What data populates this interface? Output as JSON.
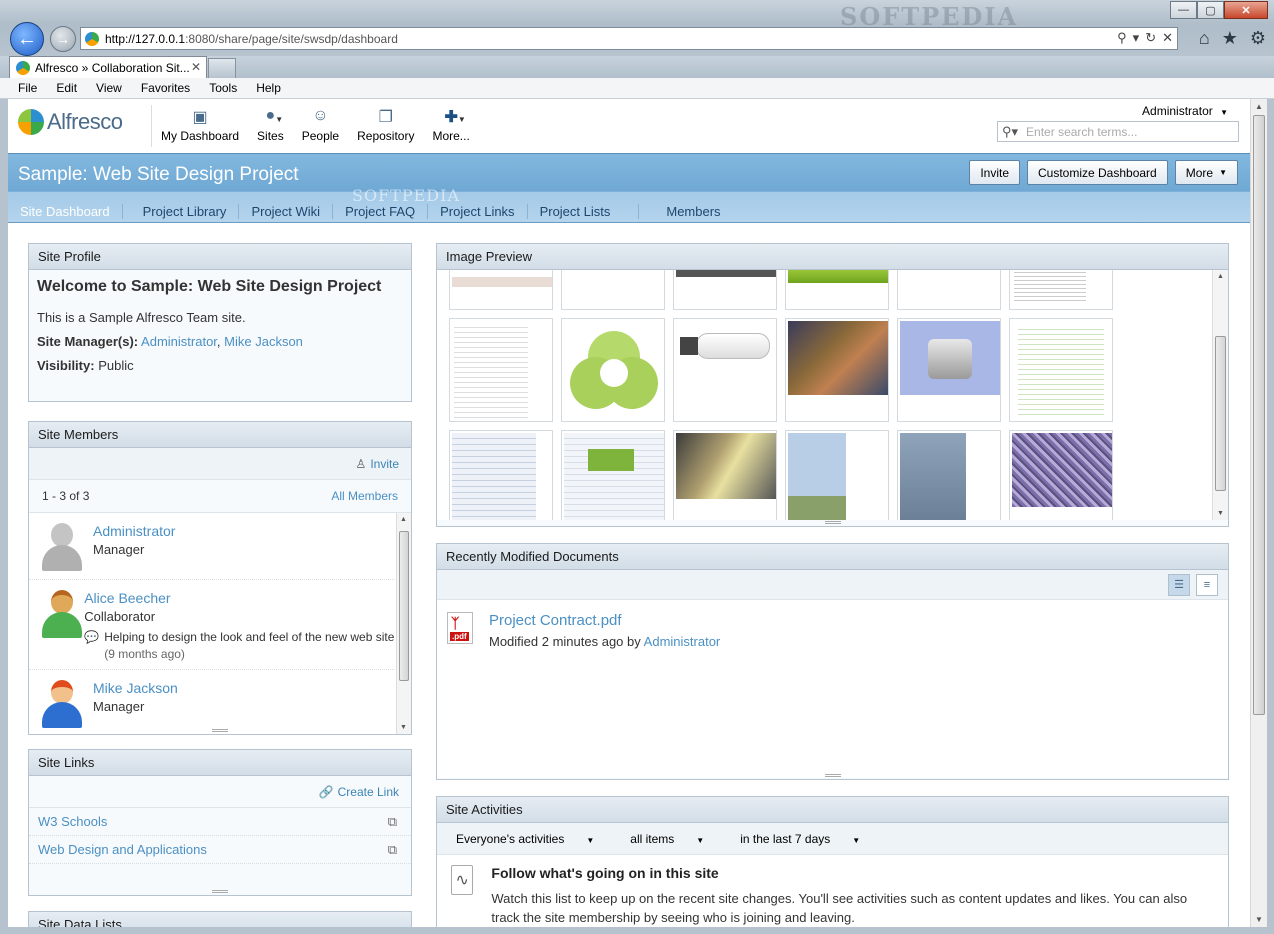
{
  "browser": {
    "watermark": "SOFTPEDIA",
    "window_controls": {
      "minimize": "—",
      "maximize": "▢",
      "close": "✕"
    },
    "url_host": "http://127.0.0.1",
    "url_path": ":8080/share/page/site/swsdp/dashboard",
    "tab_title": "Alfresco » Collaboration Sit...",
    "menu": [
      "File",
      "Edit",
      "View",
      "Favorites",
      "Tools",
      "Help"
    ]
  },
  "app": {
    "logo_text": "Alfresco",
    "nav": [
      {
        "label": "My Dashboard",
        "icon": "dashboard-icon"
      },
      {
        "label": "Sites",
        "icon": "globe-icon"
      },
      {
        "label": "People",
        "icon": "people-icon"
      },
      {
        "label": "Repository",
        "icon": "repository-icon"
      },
      {
        "label": "More...",
        "icon": "plus-icon"
      }
    ],
    "user": "Administrator",
    "search_placeholder": "Enter search terms..."
  },
  "site": {
    "title": "Sample: Web Site Design Project",
    "watermark": "SOFTPEDIA",
    "buttons": {
      "invite": "Invite",
      "customize": "Customize Dashboard",
      "more": "More"
    },
    "nav": [
      "Site Dashboard",
      "Project Library",
      "Project Wiki",
      "Project FAQ",
      "Project Links",
      "Project Lists",
      "Members"
    ]
  },
  "profile": {
    "header": "Site Profile",
    "welcome": "Welcome to Sample: Web Site Design Project",
    "description": "This is a Sample Alfresco Team site.",
    "manager_label": "Site Manager(s):",
    "manager_1": "Administrator",
    "manager_2": "Mike Jackson",
    "visibility_label": "Visibility:",
    "visibility_value": "Public"
  },
  "members": {
    "header": "Site Members",
    "invite": "Invite",
    "count": "1 - 3 of 3",
    "all_members": "All Members",
    "list": [
      {
        "name": "Administrator",
        "role": "Manager"
      },
      {
        "name": "Alice Beecher",
        "role": "Collaborator",
        "status": "Helping to design the look and feel of the new web site",
        "ago": "(9 months ago)"
      },
      {
        "name": "Mike Jackson",
        "role": "Manager"
      }
    ]
  },
  "links": {
    "header": "Site Links",
    "create": "Create Link",
    "items": [
      "W3 Schools",
      "Web Design and Applications"
    ]
  },
  "data_lists": {
    "header": "Site Data Lists"
  },
  "image_preview": {
    "header": "Image Preview"
  },
  "docs": {
    "header": "Recently Modified Documents",
    "name": "Project Contract.pdf",
    "meta_prefix": "Modified 2 minutes ago by",
    "meta_user": "Administrator",
    "pdf_label": ".pdf"
  },
  "activities": {
    "header": "Site Activities",
    "filter_1": "Everyone's activities",
    "filter_2": "all items",
    "filter_3": "in the last 7 days",
    "title": "Follow what's going on in this site",
    "text": "Watch this list to keep up on the recent site changes. You'll see activities such as content updates and likes. You can also track the site membership by seeing who is joining and leaving."
  }
}
